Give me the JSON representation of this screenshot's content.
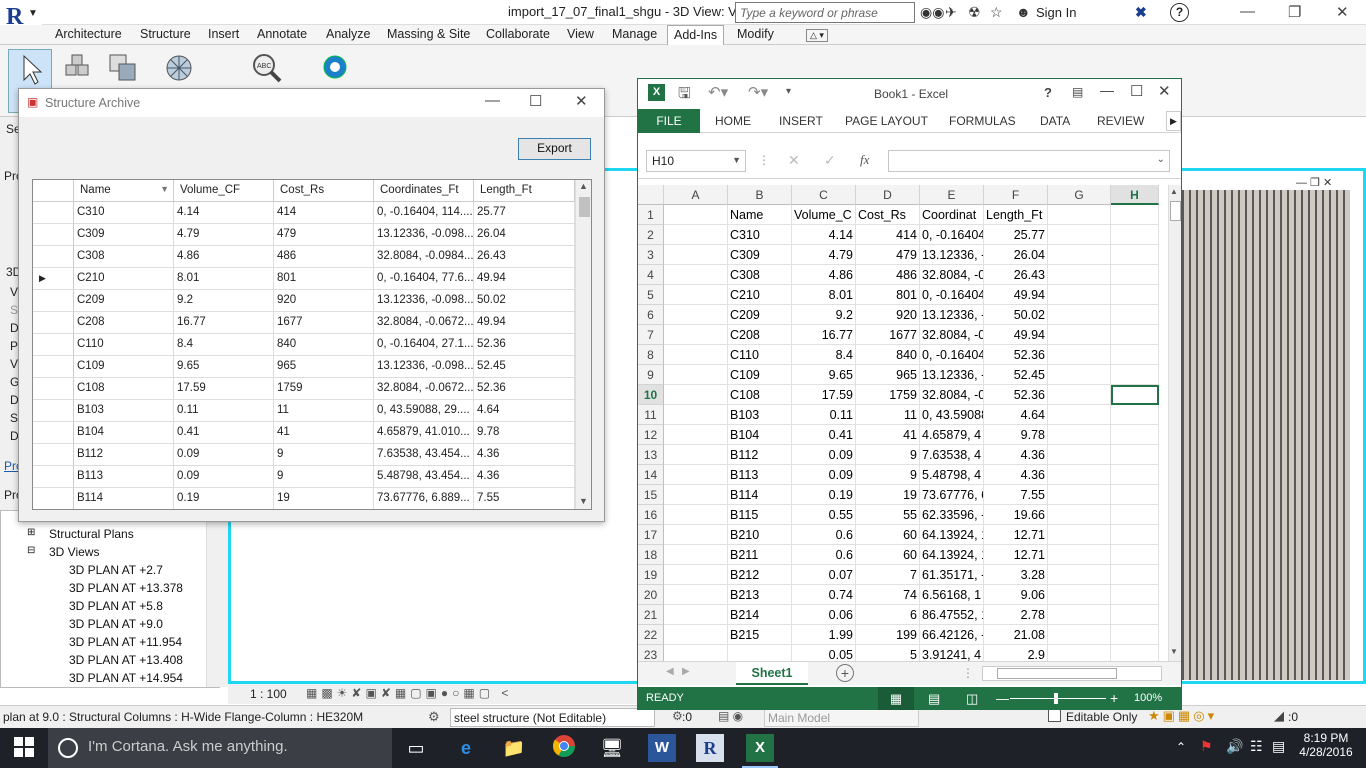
{
  "revit": {
    "window_title": "import_17_07_final1_shgu - 3D View: Vi...",
    "search_placeholder": "Type a keyword or phrase",
    "sign_in": "Sign In",
    "logo_letter": "R",
    "logo_sub": "A",
    "tabs": [
      "Architecture",
      "Structure",
      "Insert",
      "Annotate",
      "Analyze",
      "Massing & Site",
      "Collaborate",
      "View",
      "Manage",
      "Add-Ins",
      "Modify"
    ],
    "active_tab": "Add-Ins",
    "left_stub_labels": [
      "Se",
      "Pro",
      "3D",
      "Vi",
      "Sc",
      "De",
      "Pa",
      "Vi",
      "Gr",
      "Di",
      "Sk",
      "De",
      "Pro",
      "Pro"
    ],
    "tree": {
      "items": [
        "Structural Plans",
        "3D Views",
        "3D PLAN AT  +2.7",
        "3D PLAN AT  +13.378",
        "3D PLAN AT +5.8",
        "3D PLAN AT +9.0",
        "3D PLAN AT +11.954",
        "3D PLAN AT +13.408",
        "3D PLAN AT +14.954"
      ]
    },
    "scale": "1 : 100",
    "status_text": "plan at 9.0 : Structural Columns : H-Wide Flange-Column : HE320M",
    "workset": "steel structure (Not Editable)",
    "zero_a": ":0",
    "main_model": "Main Model",
    "editable_only": "Editable Only",
    "zero_b": ":0"
  },
  "dialog": {
    "title": "Structure Archive",
    "export_label": "Export",
    "columns": [
      "Name",
      "Volume_CF",
      "Cost_Rs",
      "Coordinates_Ft",
      "Length_Ft"
    ],
    "rows": [
      [
        "C310",
        "4.14",
        "414",
        "0, -0.16404, 114....",
        "25.77"
      ],
      [
        "C309",
        "4.79",
        "479",
        "13.12336, -0.098...",
        "26.04"
      ],
      [
        "C308",
        "4.86",
        "486",
        "32.8084, -0.0984...",
        "26.43"
      ],
      [
        "C210",
        "8.01",
        "801",
        "0, -0.16404, 77.6...",
        "49.94"
      ],
      [
        "C209",
        "9.2",
        "920",
        "13.12336, -0.098...",
        "50.02"
      ],
      [
        "C208",
        "16.77",
        "1677",
        "32.8084, -0.0672...",
        "49.94"
      ],
      [
        "C110",
        "8.4",
        "840",
        "0, -0.16404, 27.1...",
        "52.36"
      ],
      [
        "C109",
        "9.65",
        "965",
        "13.12336, -0.098...",
        "52.45"
      ],
      [
        "C108",
        "17.59",
        "1759",
        "32.8084, -0.0672...",
        "52.36"
      ],
      [
        "B103",
        "0.11",
        "11",
        "0, 43.59088, 29....",
        "4.64"
      ],
      [
        "B104",
        "0.41",
        "41",
        "4.65879, 41.010...",
        "9.78"
      ],
      [
        "B112",
        "0.09",
        "9",
        "7.63538, 43.454...",
        "4.36"
      ],
      [
        "B113",
        "0.09",
        "9",
        "5.48798, 43.454...",
        "4.36"
      ],
      [
        "B114",
        "0.19",
        "19",
        "73.67776, 6.889...",
        "7.55"
      ]
    ],
    "current_row_marker": "▶"
  },
  "excel": {
    "title": "Book1 - Excel",
    "help": "?",
    "file_tab": "FILE",
    "tabs": [
      "HOME",
      "INSERT",
      "PAGE LAYOUT",
      "FORMULAS",
      "DATA",
      "REVIEW"
    ],
    "name_box": "H10",
    "fx": "fx",
    "col_headers": [
      "A",
      "B",
      "C",
      "D",
      "E",
      "F",
      "G",
      "H"
    ],
    "rows": [
      [
        "1",
        "",
        "Name",
        "Volume_C",
        "Cost_Rs",
        "Coordinat",
        "Length_Ft"
      ],
      [
        "2",
        "",
        "C310",
        "4.14",
        "414",
        "0, -0.16404",
        "25.77"
      ],
      [
        "3",
        "",
        "C309",
        "4.79",
        "479",
        "13.12336, -",
        "26.04"
      ],
      [
        "4",
        "",
        "C308",
        "4.86",
        "486",
        "32.8084, -0",
        "26.43"
      ],
      [
        "5",
        "",
        "C210",
        "8.01",
        "801",
        "0, -0.16404",
        "49.94"
      ],
      [
        "6",
        "",
        "C209",
        "9.2",
        "920",
        "13.12336, -",
        "50.02"
      ],
      [
        "7",
        "",
        "C208",
        "16.77",
        "1677",
        "32.8084, -0",
        "49.94"
      ],
      [
        "8",
        "",
        "C110",
        "8.4",
        "840",
        "0, -0.16404",
        "52.36"
      ],
      [
        "9",
        "",
        "C109",
        "9.65",
        "965",
        "13.12336, -",
        "52.45"
      ],
      [
        "10",
        "",
        "C108",
        "17.59",
        "1759",
        "32.8084, -0",
        "52.36"
      ],
      [
        "11",
        "",
        "B103",
        "0.11",
        "11",
        "0, 43.59088",
        "4.64"
      ],
      [
        "12",
        "",
        "B104",
        "0.41",
        "41",
        "4.65879, 4",
        "9.78"
      ],
      [
        "13",
        "",
        "B112",
        "0.09",
        "9",
        "7.63538, 4",
        "4.36"
      ],
      [
        "14",
        "",
        "B113",
        "0.09",
        "9",
        "5.48798, 4",
        "4.36"
      ],
      [
        "15",
        "",
        "B114",
        "0.19",
        "19",
        "73.67776, 6",
        "7.55"
      ],
      [
        "16",
        "",
        "B115",
        "0.55",
        "55",
        "62.33596, -",
        "19.66"
      ],
      [
        "17",
        "",
        "B210",
        "0.6",
        "60",
        "64.13924, 1",
        "12.71"
      ],
      [
        "18",
        "",
        "B211",
        "0.6",
        "60",
        "64.13924, 1",
        "12.71"
      ],
      [
        "19",
        "",
        "B212",
        "0.07",
        "7",
        "61.35171, -",
        "3.28"
      ],
      [
        "20",
        "",
        "B213",
        "0.74",
        "74",
        "6.56168, 1",
        "9.06"
      ],
      [
        "21",
        "",
        "B214",
        "0.06",
        "6",
        "86.47552, 1",
        "2.78"
      ],
      [
        "22",
        "",
        "B215",
        "1.99",
        "199",
        "66.42126, -",
        "21.08"
      ],
      [
        "23",
        "",
        "",
        "0.05",
        "5",
        "3.91241, 4",
        "2.9"
      ]
    ],
    "sheet_tab": "Sheet1",
    "status": "READY",
    "zoom": "100%",
    "selected_cell": "H10"
  },
  "taskbar": {
    "cortana": "I'm Cortana. Ask me anything.",
    "time": "8:19 PM",
    "date": "4/28/2016"
  },
  "colors": {
    "excel_green": "#217346",
    "viewport_border": "#1fd7f0",
    "revit_blue": "#1a3e8f"
  }
}
